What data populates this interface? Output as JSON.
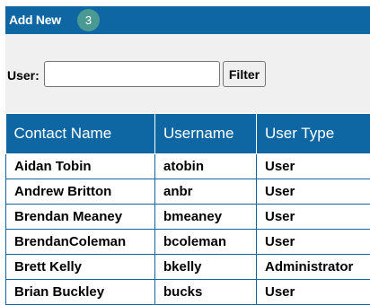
{
  "header": {
    "add_new_label": "Add New",
    "badge_count": "3"
  },
  "filter": {
    "user_label": "User:",
    "user_value": "",
    "button_label": "Filter"
  },
  "table": {
    "columns": [
      "Contact Name",
      "Username",
      "User Type"
    ],
    "rows": [
      [
        "Aidan Tobin",
        "atobin",
        "User"
      ],
      [
        "Andrew Britton",
        "anbr",
        "User"
      ],
      [
        "Brendan Meaney",
        "bmeaney",
        "User"
      ],
      [
        "BrendanColeman",
        "bcoleman",
        "User"
      ],
      [
        "Brett Kelly",
        "bkelly",
        "Administrator"
      ],
      [
        "Brian Buckley",
        "bucks",
        "User"
      ]
    ]
  },
  "colors": {
    "header_blue": "#0e67a3",
    "badge_teal": "#4a9a93",
    "filter_background": "#f0f0f0"
  }
}
